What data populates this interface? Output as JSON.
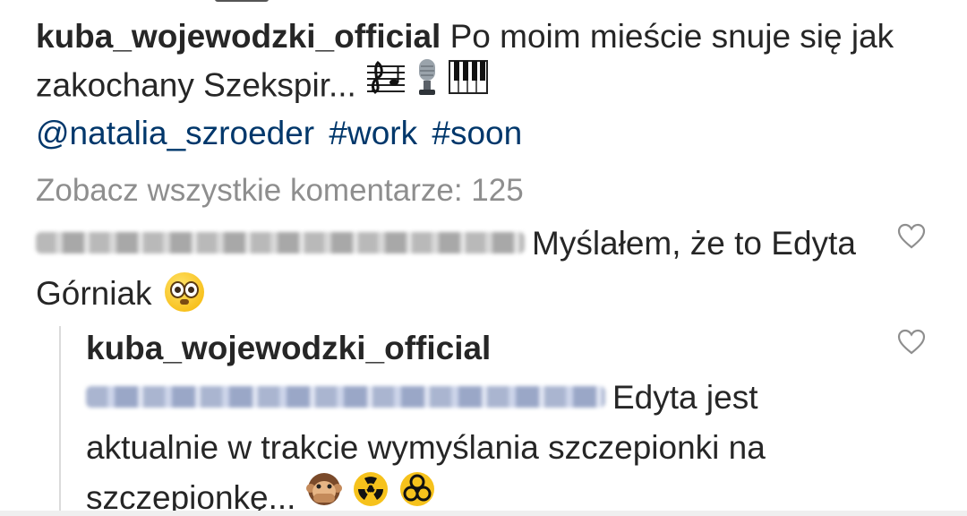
{
  "post": {
    "username": "kuba_wojewodzki_official",
    "caption": "Po moim mieście snuje się jak zakochany Szekspir...",
    "caption_emojis": [
      "musical-score",
      "microphone",
      "musical-keyboard"
    ],
    "tags": [
      "@natalia_szroeder",
      "#work",
      "#soon"
    ],
    "view_all_comments": "Zobacz wszystkie komentarze: 125"
  },
  "comment": {
    "text": "Myślałem, że to Edyta Górniak",
    "emoji": "flushed-face",
    "username_blurred": true
  },
  "reply": {
    "username": "kuba_wojewodzki_official",
    "text": "Edyta jest aktualnie w trakcie wymyślania szczepionki na szczepionkę...",
    "emojis": [
      "speak-no-evil-monkey",
      "radioactive",
      "biohazard"
    ],
    "mention_blurred": true
  },
  "colors": {
    "text": "#262626",
    "link": "#00376b",
    "muted": "#8e8e8e",
    "thread_line": "#dbdbdb"
  }
}
